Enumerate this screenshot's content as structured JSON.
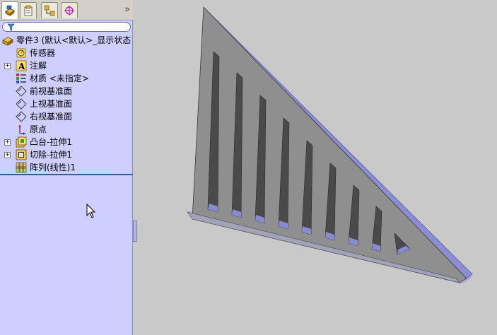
{
  "panel": {
    "tabs": [
      {
        "name": "featuremanager-tab",
        "icon": "feature-tree-icon"
      },
      {
        "name": "propertymanager-tab",
        "icon": "property-icon"
      },
      {
        "name": "configurationmanager-tab",
        "icon": "configuration-icon"
      },
      {
        "name": "dimxpert-tab",
        "icon": "target-icon"
      }
    ],
    "expand_symbol": "»",
    "filter_icon": "filter-icon"
  },
  "tree": {
    "root": {
      "label": "零件3   (默认<默认>_显示状态",
      "icon": "part-icon"
    },
    "items": [
      {
        "label": "传感器",
        "icon": "sensor-icon",
        "expandable": false
      },
      {
        "label": "注解",
        "icon": "annotation-icon",
        "expandable": true
      },
      {
        "label": "材质 <未指定>",
        "icon": "material-icon",
        "expandable": false
      },
      {
        "label": "前视基准面",
        "icon": "plane-icon",
        "expandable": false
      },
      {
        "label": "上视基准面",
        "icon": "plane-icon",
        "expandable": false
      },
      {
        "label": "右视基准面",
        "icon": "plane-icon",
        "expandable": false
      },
      {
        "label": "原点",
        "icon": "origin-icon",
        "expandable": false
      },
      {
        "label": "凸台-拉伸1",
        "icon": "extrude-boss-icon",
        "expandable": true
      },
      {
        "label": "切除-拉伸1",
        "icon": "extrude-cut-icon",
        "expandable": true
      },
      {
        "label": "阵列(线性)1",
        "icon": "linear-pattern-icon",
        "expandable": false
      }
    ]
  },
  "colors": {
    "panel_bg": "#cfcfff",
    "viewport_bg": "#c9c9c9",
    "model_face": "#8c8c8c",
    "model_edge": "#8a8ad6",
    "selection_line": "#2d5fa0"
  }
}
